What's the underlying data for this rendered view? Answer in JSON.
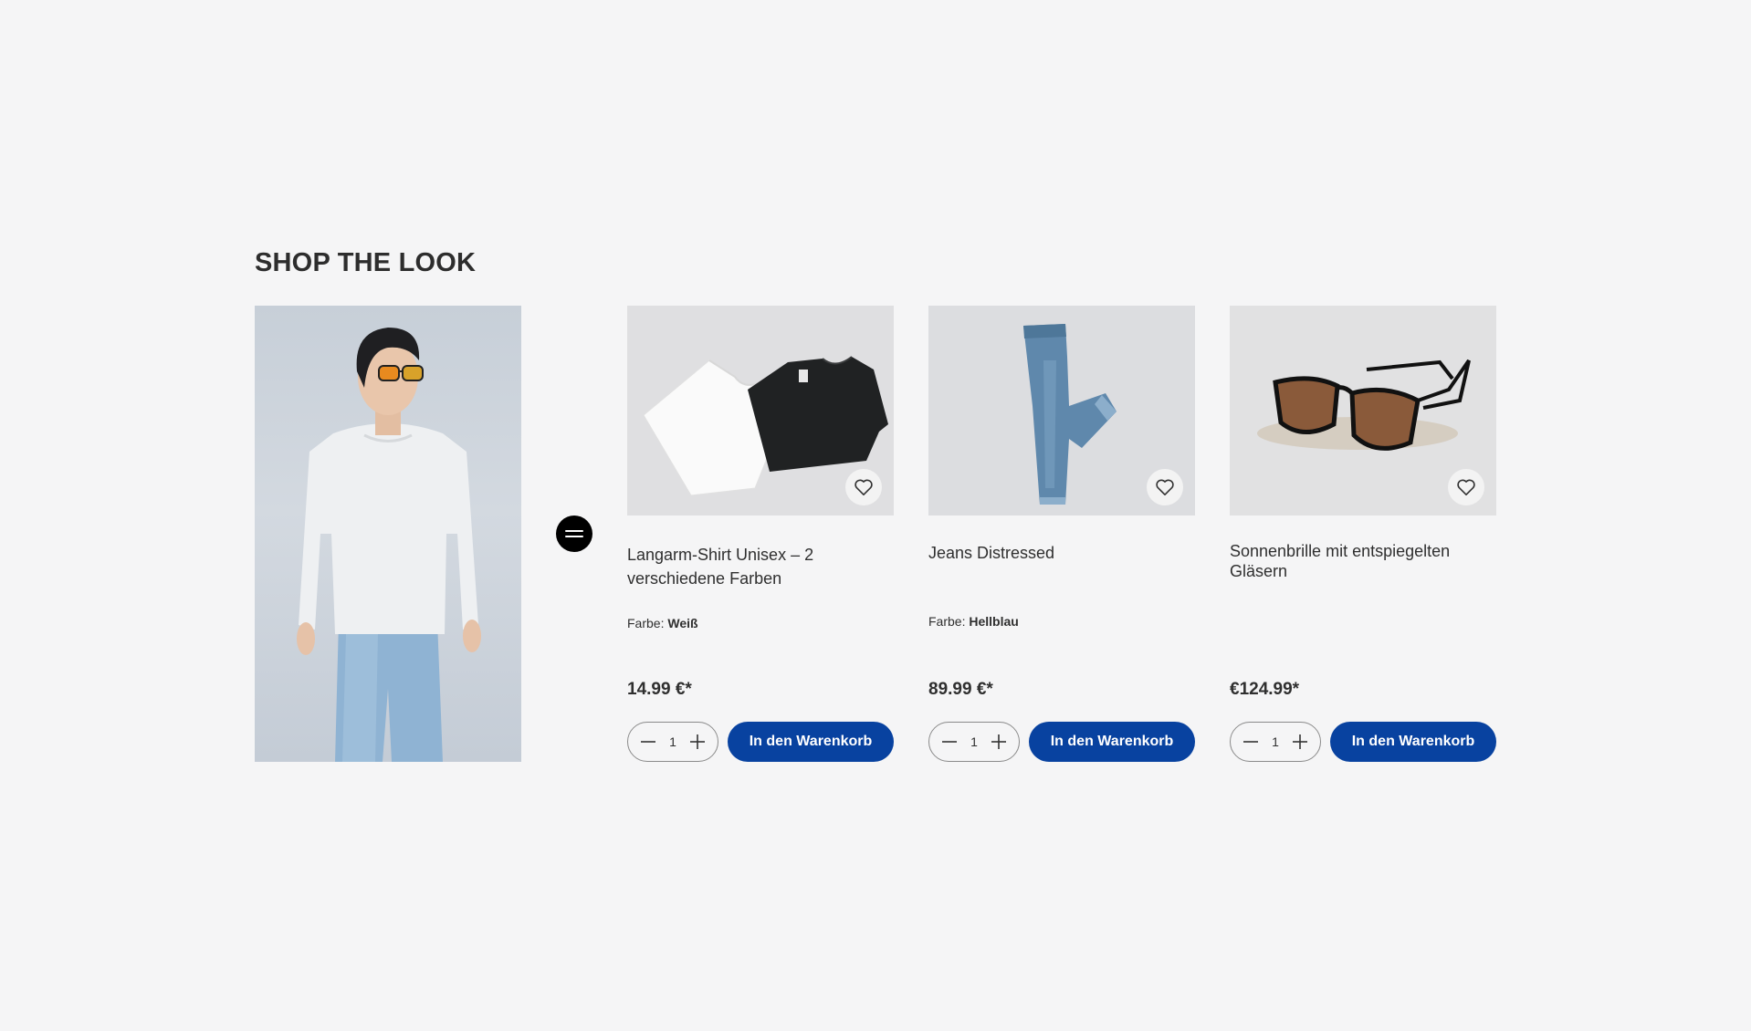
{
  "section": {
    "title": "SHOP THE LOOK"
  },
  "look": {
    "image_alt": "Model wearing white long-sleeve shirt, light blue jeans and tinted sunglasses"
  },
  "icons": {
    "equals": "equals-icon",
    "wishlist": "heart-icon",
    "minus": "minus-icon",
    "plus": "plus-icon"
  },
  "colors": {
    "accent": "#0842a0",
    "background": "#f5f5f6",
    "badge": "#000000"
  },
  "products": [
    {
      "name": "Langarm-Shirt Unisex – 2 verschiedene Farben",
      "variant_label": "Farbe:",
      "variant_value": "Weiß",
      "price": "14.99 €*",
      "quantity": "1",
      "cart_label": "In den Warenkorb"
    },
    {
      "name": "Jeans Distressed",
      "variant_label": "Farbe:",
      "variant_value": "Hellblau",
      "price": "89.99 €*",
      "quantity": "1",
      "cart_label": "In den Warenkorb"
    },
    {
      "name": "Sonnenbrille mit entspiegelten Gläsern",
      "price": "€124.99*",
      "quantity": "1",
      "cart_label": "In den Warenkorb"
    }
  ]
}
